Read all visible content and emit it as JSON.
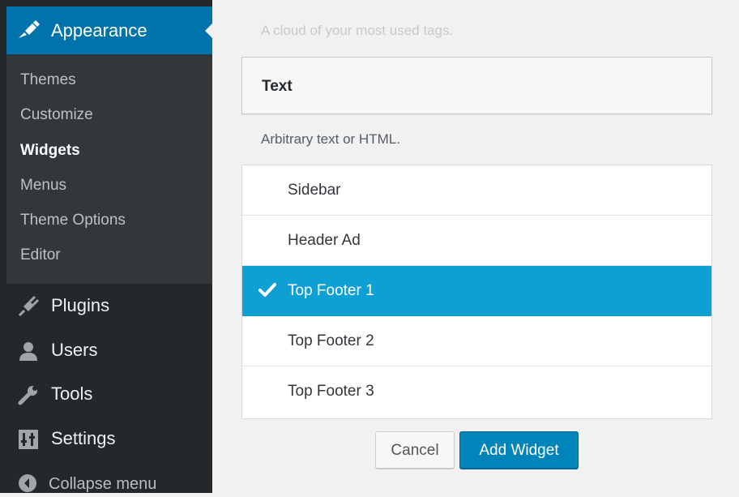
{
  "sidebar": {
    "appearance": {
      "label": "Appearance",
      "icon": "paintbrush-icon"
    },
    "submenu": [
      {
        "label": "Themes",
        "current": false
      },
      {
        "label": "Customize",
        "current": false
      },
      {
        "label": "Widgets",
        "current": true
      },
      {
        "label": "Menus",
        "current": false
      },
      {
        "label": "Theme Options",
        "current": false
      },
      {
        "label": "Editor",
        "current": false
      }
    ],
    "menu": [
      {
        "label": "Plugins",
        "icon": "plugin-icon"
      },
      {
        "label": "Users",
        "icon": "user-icon"
      },
      {
        "label": "Tools",
        "icon": "wrench-icon"
      },
      {
        "label": "Settings",
        "icon": "settings-icon"
      }
    ],
    "collapse_label": "Collapse menu"
  },
  "main": {
    "faded_description": "A cloud of your most used tags.",
    "widget": {
      "title": "Text",
      "description": "Arbitrary text or HTML."
    },
    "areas": [
      {
        "label": "Sidebar",
        "selected": false
      },
      {
        "label": "Header Ad",
        "selected": false
      },
      {
        "label": "Top Footer 1",
        "selected": true
      },
      {
        "label": "Top Footer 2",
        "selected": false
      },
      {
        "label": "Top Footer 3",
        "selected": false
      }
    ],
    "buttons": {
      "cancel": "Cancel",
      "add": "Add Widget"
    }
  },
  "colors": {
    "admin_menu_bg": "#23282d",
    "submenu_bg": "#32373c",
    "accent": "#0073aa",
    "selected_area": "#0ea0d4",
    "primary_button": "#0085ba"
  }
}
